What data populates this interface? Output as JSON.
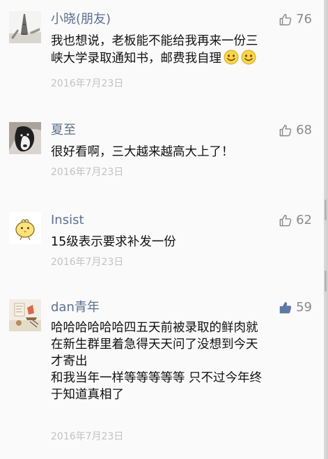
{
  "comments": [
    {
      "name": "小晓(朋友)",
      "likes": "76",
      "liked": false,
      "avatar_icon": "eiffel-tower-photo",
      "lines": [
        "我也想说，老板能不能给我再来一份三",
        "峡大学录取通知书，邮费我自理"
      ],
      "emoji_icons": [
        "smiley-emoji",
        "smiley-emoji"
      ],
      "date": "2016年7月23日"
    },
    {
      "name": "夏至",
      "likes": "68",
      "liked": false,
      "avatar_icon": "dog-photo",
      "lines": [
        "很好看啊，三大越来越高大上了！"
      ],
      "date": "2016年7月23日"
    },
    {
      "name": "Insist",
      "likes": "62",
      "liked": false,
      "avatar_icon": "chick-cartoon",
      "lines": [
        "15级表示要求补发一份"
      ],
      "date": "2016年7月23日"
    },
    {
      "name": "dan青年⁣",
      "likes": "59",
      "liked": true,
      "avatar_icon": "illustration-photo",
      "lines": [
        "哈哈哈哈哈哈四五天前被录取的鲜肉就",
        "在新生群里着急得天天问了没想到今天",
        "才寄出",
        "和我当年一样等等等等等 只不过今年终",
        "于知道真相了"
      ],
      "date": "2016年7月23日"
    }
  ],
  "colors": {
    "name": "#5f6f8f",
    "content": "#111111",
    "date": "#c2c2c2",
    "like_outline": "#8a8a8a",
    "like_active": "#6079a4",
    "background": "#fafafa"
  }
}
